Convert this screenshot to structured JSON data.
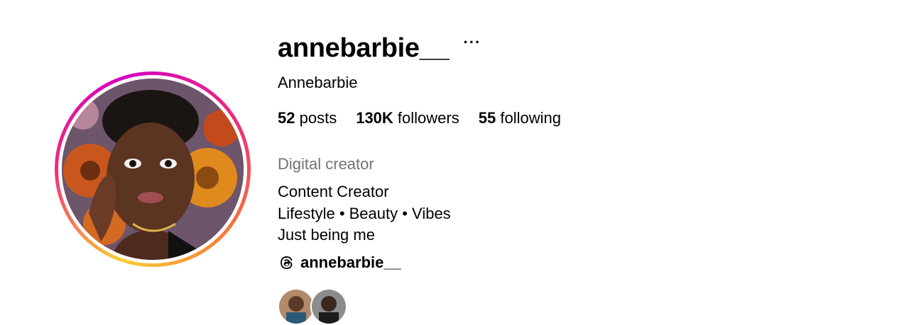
{
  "profile": {
    "username": "annebarbie__",
    "more_icon": "more-horizontal-icon",
    "full_name": "Annebarbie",
    "stats": [
      {
        "count": "52",
        "label": "posts"
      },
      {
        "count": "130K",
        "label": "followers"
      },
      {
        "count": "55",
        "label": "following"
      }
    ],
    "category": "Digital creator",
    "bio_lines": [
      "Content Creator",
      "Lifestyle • Beauty • Vibes",
      "Just being me"
    ],
    "threads": {
      "icon": "threads-icon",
      "handle": "annebarbie__"
    }
  },
  "colors": {
    "text": "#000000",
    "secondary": "#737373",
    "ring_gradient": [
      "#f9ce34",
      "#ee2a7b",
      "#d300c5"
    ]
  }
}
